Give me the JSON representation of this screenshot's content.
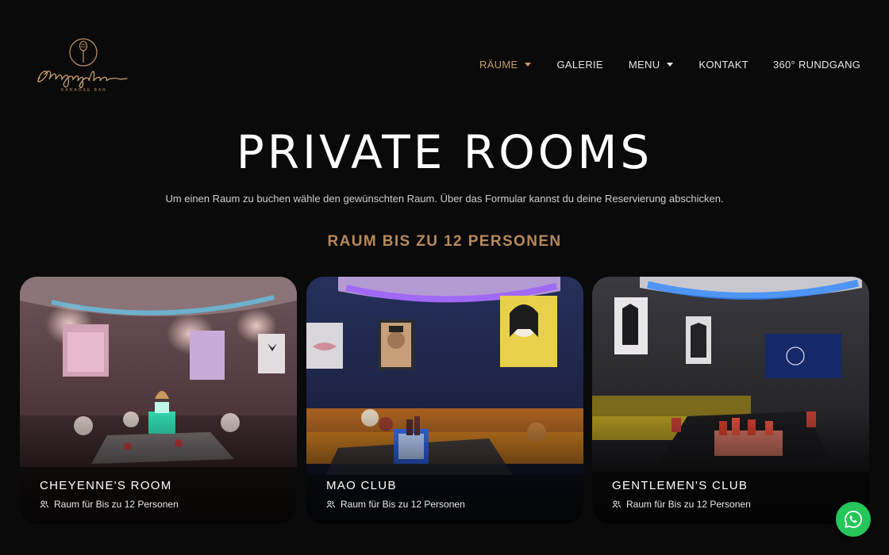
{
  "header": {
    "logo": {
      "script": "Shangrila",
      "subtitle": "KARAOKE BAR"
    },
    "nav": [
      {
        "label": "RÄUME",
        "active": true,
        "dropdown": true
      },
      {
        "label": "GALERIE",
        "active": false,
        "dropdown": false
      },
      {
        "label": "MENU",
        "active": false,
        "dropdown": true
      },
      {
        "label": "KONTAKT",
        "active": false,
        "dropdown": false
      },
      {
        "label": "360° RUNDGANG",
        "active": false,
        "dropdown": false
      }
    ]
  },
  "hero": {
    "title": "PRIVATE ROOMS",
    "subtitle": "Um einen Raum zu buchen wähle den gewünschten Raum. Über das Formular kannst du deine Reservierung abschicken."
  },
  "section": {
    "title": "RAUM BIS ZU 12 PERSONEN"
  },
  "rooms": [
    {
      "name": "CHEYENNE'S ROOM",
      "capacity": "Raum für Bis zu 12 Personen",
      "icon": "people-icon",
      "accent": "#c79ab0"
    },
    {
      "name": "MAO CLUB",
      "capacity": "Raum für Bis zu 12 Personen",
      "icon": "people-icon",
      "accent": "#7a4fd8"
    },
    {
      "name": "GENTLEMEN'S CLUB",
      "capacity": "Raum für Bis zu 12 Personen",
      "icon": "people-icon",
      "accent": "#2f7cf0"
    }
  ],
  "whatsapp": {
    "icon": "whatsapp-icon",
    "color": "#25c65a"
  },
  "colors": {
    "background": "#0a0a0a",
    "accent_gold": "#b8895a",
    "nav_active": "#c89b6a"
  }
}
